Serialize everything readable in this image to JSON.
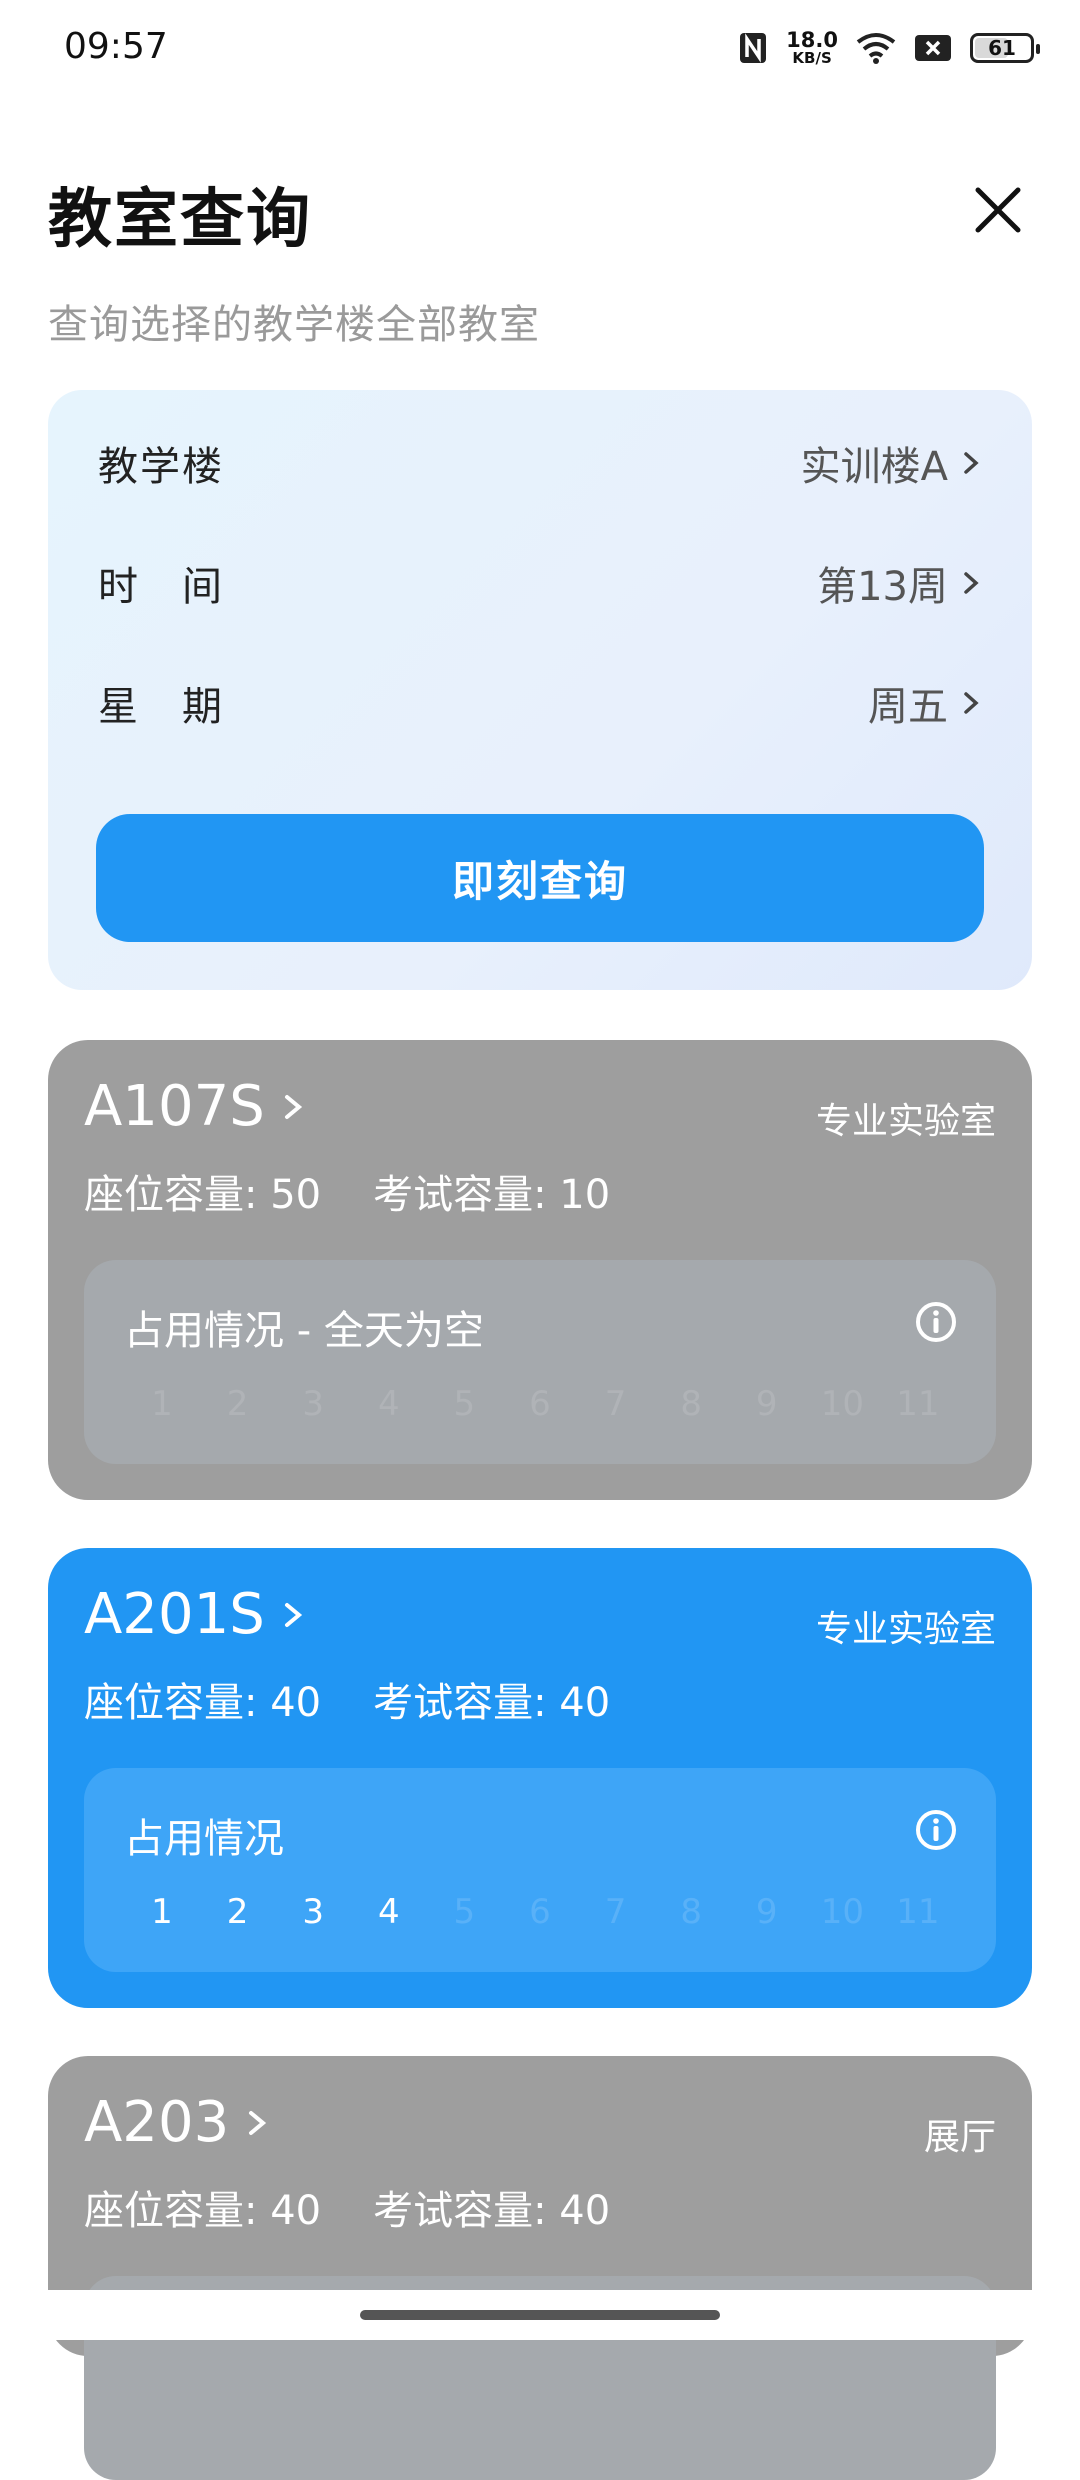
{
  "status_bar": {
    "time": "09:57",
    "net_speed_value": "18.0",
    "net_speed_unit": "KB/S",
    "battery": "61",
    "battery_level": 0.61,
    "icons": [
      "nfc-icon",
      "wifi-icon",
      "sim-off-icon",
      "battery-icon"
    ]
  },
  "header": {
    "title": "教室查询",
    "subtitle": "查询选择的教学楼全部教室",
    "close_icon": "close-icon"
  },
  "query": {
    "rows": [
      {
        "label": "教学楼",
        "value": "实训楼A"
      },
      {
        "label": "时　间",
        "value": "第13周"
      },
      {
        "label": "星　期",
        "value": "周五"
      }
    ],
    "button_label": "即刻查询"
  },
  "rooms": [
    {
      "name": "A107S",
      "type": "专业实验室",
      "seat_capacity": "座位容量: 50",
      "exam_capacity": "考试容量: 10",
      "usage_title": "占用情况 - 全天为空",
      "periods": [
        "1",
        "2",
        "3",
        "4",
        "5",
        "6",
        "7",
        "8",
        "9",
        "10",
        "11"
      ],
      "occupied": [],
      "style": "gray"
    },
    {
      "name": "A201S",
      "type": "专业实验室",
      "seat_capacity": "座位容量: 40",
      "exam_capacity": "考试容量: 40",
      "usage_title": "占用情况",
      "periods": [
        "1",
        "2",
        "3",
        "4",
        "5",
        "6",
        "7",
        "8",
        "9",
        "10",
        "11"
      ],
      "occupied": [
        "1",
        "2",
        "3",
        "4"
      ],
      "style": "blue"
    },
    {
      "name": "A203",
      "type": "展厅",
      "seat_capacity": "座位容量: 40",
      "exam_capacity": "考试容量: 40",
      "style": "gray"
    }
  ],
  "colors": {
    "accent": "#2196f3",
    "card_gray": "#9e9e9e",
    "query_card_bg": "#e6f4fd"
  }
}
